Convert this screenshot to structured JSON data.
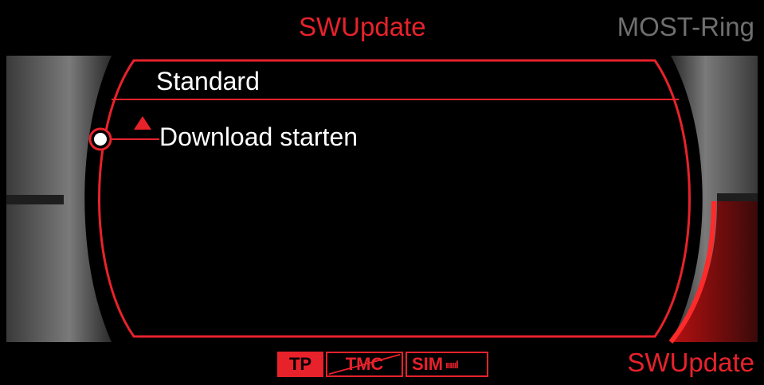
{
  "header": {
    "left_label": "SWUpdate",
    "right_label": "MOST-Ring"
  },
  "menu": {
    "title": "Standard",
    "items": [
      "Download starten"
    ]
  },
  "footer": {
    "right_label": "SWUpdate",
    "indicators": {
      "tp": "TP",
      "tmc": "TMC",
      "sim": "SIM",
      "signal": "ıııııl"
    }
  },
  "colors": {
    "accent": "#e8222b",
    "inactive_text": "#6f6f6f",
    "background": "#000000",
    "text": "#ffffff"
  },
  "icons": {
    "up_arrow": "triangle-up-icon",
    "cursor": "selection-dot-icon",
    "tmc_crossed": "strikethrough"
  }
}
